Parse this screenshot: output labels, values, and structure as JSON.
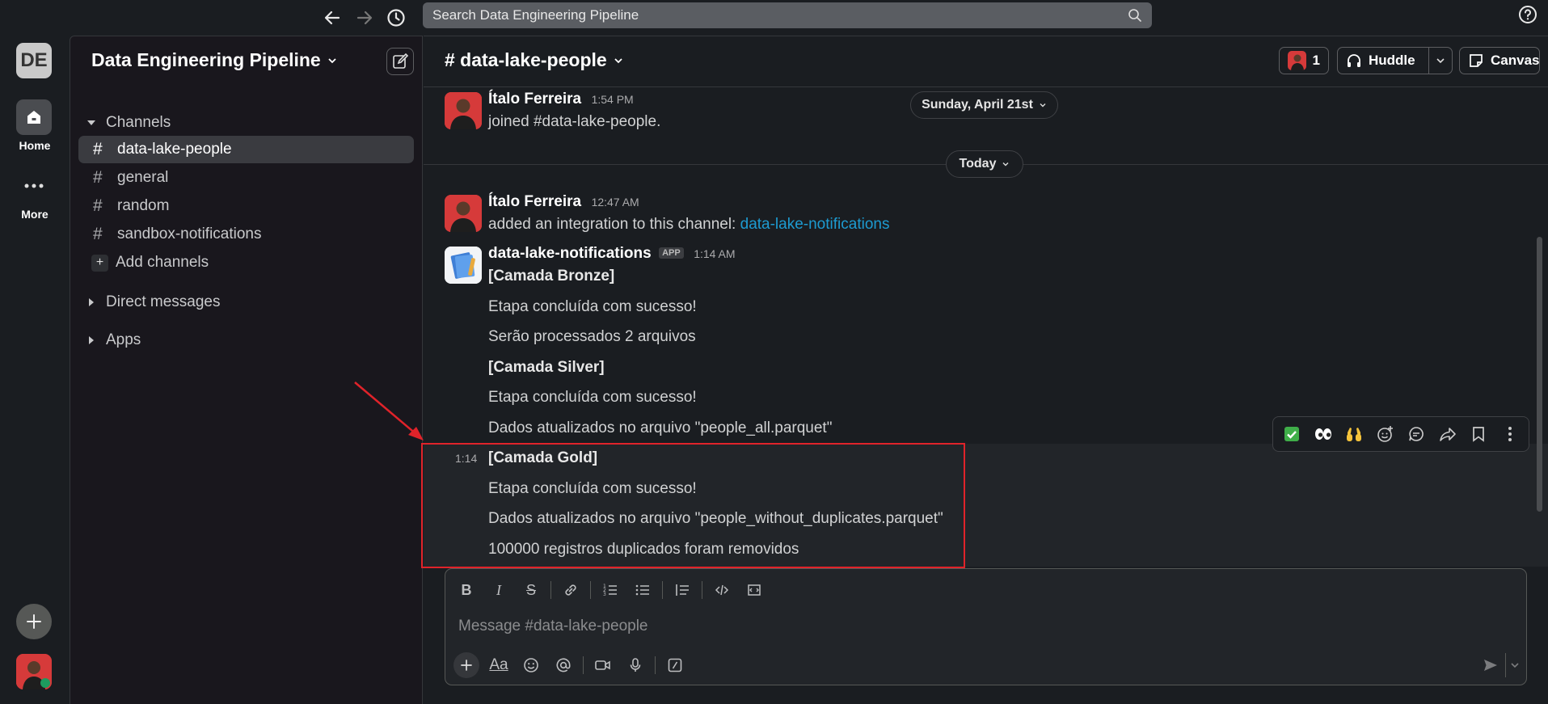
{
  "topbar": {
    "search_placeholder": "Search Data Engineering Pipeline",
    "nav_icons": [
      "arrow-left-icon",
      "arrow-right-icon",
      "history-icon"
    ],
    "help_icon": "help-icon"
  },
  "rail": {
    "workspace_initials": "DE",
    "home_label": "Home",
    "more_label": "More"
  },
  "sidebar": {
    "workspace_name": "Data Engineering Pipeline",
    "channels_header": "Channels",
    "channels": [
      {
        "name": "data-lake-people",
        "active": true
      },
      {
        "name": "general",
        "active": false
      },
      {
        "name": "random",
        "active": false
      },
      {
        "name": "sandbox-notifications",
        "active": false
      }
    ],
    "add_channels": "Add channels",
    "direct_messages": "Direct messages",
    "apps": "Apps"
  },
  "channel": {
    "title": "# data-lake-people",
    "member_count": "1",
    "huddle_label": "Huddle",
    "canvas_label": "Canvas",
    "date_pill_1": "Sunday, April 21st",
    "date_pill_2": "Today",
    "messages": {
      "m1": {
        "author": "Ítalo Ferreira",
        "time": "1:54 PM",
        "text": "joined #data-lake-people."
      },
      "m2": {
        "author": "Ítalo Ferreira",
        "time": "12:47 AM",
        "text": "added an integration to this channel: ",
        "link": "data-lake-notifications"
      },
      "m3": {
        "author": "data-lake-notifications",
        "badge": "APP",
        "time": "1:14 AM",
        "lines": [
          "[Camada Bronze]",
          "Etapa concluída com sucesso!",
          "Serão processados 2 arquivos",
          "[Camada Silver]",
          "Etapa concluída com sucesso!",
          "Dados atualizados no arquivo \"people_all.parquet\""
        ]
      },
      "m4": {
        "time": "1:14",
        "lines": [
          "[Camada Gold]",
          "Etapa concluída com sucesso!",
          "Dados atualizados no arquivo \"people_without_duplicates.parquet\"",
          "100000 registros duplicados foram removidos"
        ]
      }
    },
    "hover_actions": [
      "check-reaction-icon",
      "eyes-reaction-icon",
      "raised-hands-reaction-icon",
      "add-reaction-icon",
      "reply-thread-icon",
      "forward-icon",
      "bookmark-icon",
      "more-actions-icon"
    ],
    "composer": {
      "placeholder": "Message #data-lake-people",
      "format_icons": [
        "bold-icon",
        "italic-icon",
        "strikethrough-icon",
        "link-icon",
        "ordered-list-icon",
        "bullet-list-icon",
        "blockquote-icon",
        "code-icon",
        "code-block-icon"
      ],
      "bottom_icons": [
        "plus-icon",
        "text-format-icon",
        "emoji-icon",
        "mention-icon",
        "video-icon",
        "microphone-icon",
        "slash-command-icon"
      ],
      "format_label": "Aa"
    }
  },
  "colors": {
    "background": "#1a1d21",
    "sidebar": "#19171d",
    "link": "#1d9bd1",
    "highlight_box": "#e0232a",
    "annotation_arrow": "#e0232a"
  }
}
